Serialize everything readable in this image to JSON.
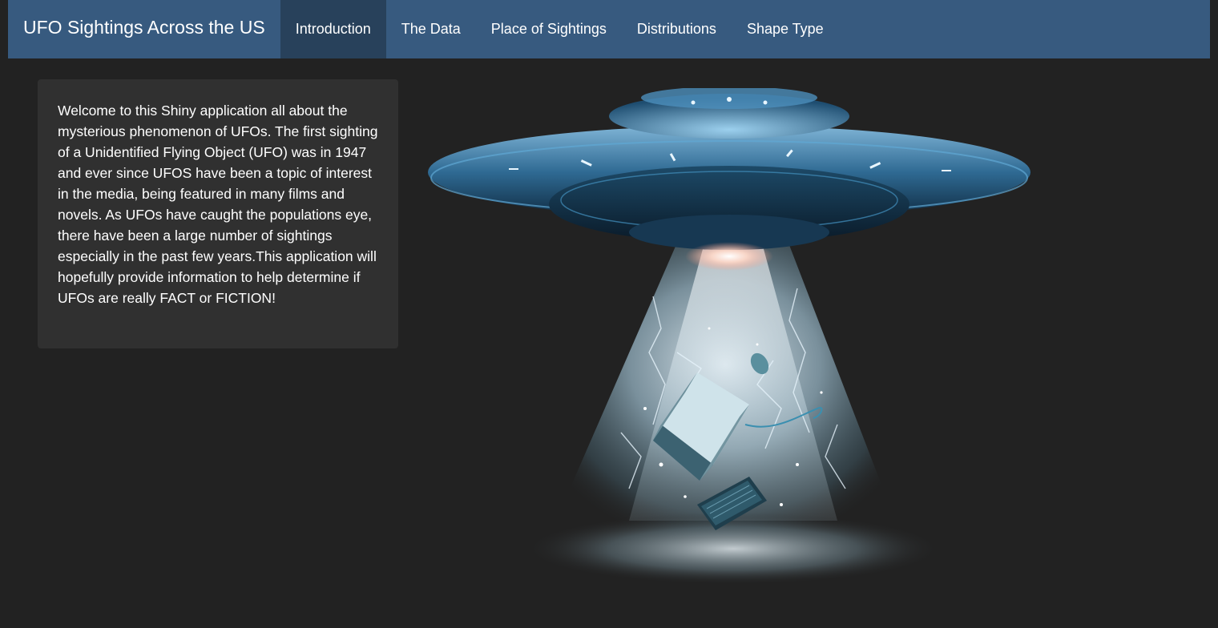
{
  "navbar": {
    "brand": "UFO Sightings Across the US",
    "tabs": [
      {
        "label": "Introduction",
        "active": true
      },
      {
        "label": "The Data",
        "active": false
      },
      {
        "label": "Place of Sightings",
        "active": false
      },
      {
        "label": "Distributions",
        "active": false
      },
      {
        "label": "Shape Type",
        "active": false
      }
    ]
  },
  "intro": {
    "text": "Welcome to this Shiny application all about the mysterious phenomenon of UFOs. The first sighting of a Unidentified Flying Object (UFO) was in 1947 and ever since UFOS have been a topic of interest in the media, being featured in many films and novels. As UFOs have caught the populations eye, there have been a large number of sightings especially in the past few years.This application will hopefully provide information to help determine if UFOs are really FACT or FICTION!"
  },
  "colors": {
    "page_background": "#222222",
    "navbar_background": "#375a7f",
    "active_tab_background": "#28415b",
    "well_background": "#303030",
    "text": "#ffffff"
  },
  "image": {
    "subject": "ufo-abducting-computer"
  }
}
